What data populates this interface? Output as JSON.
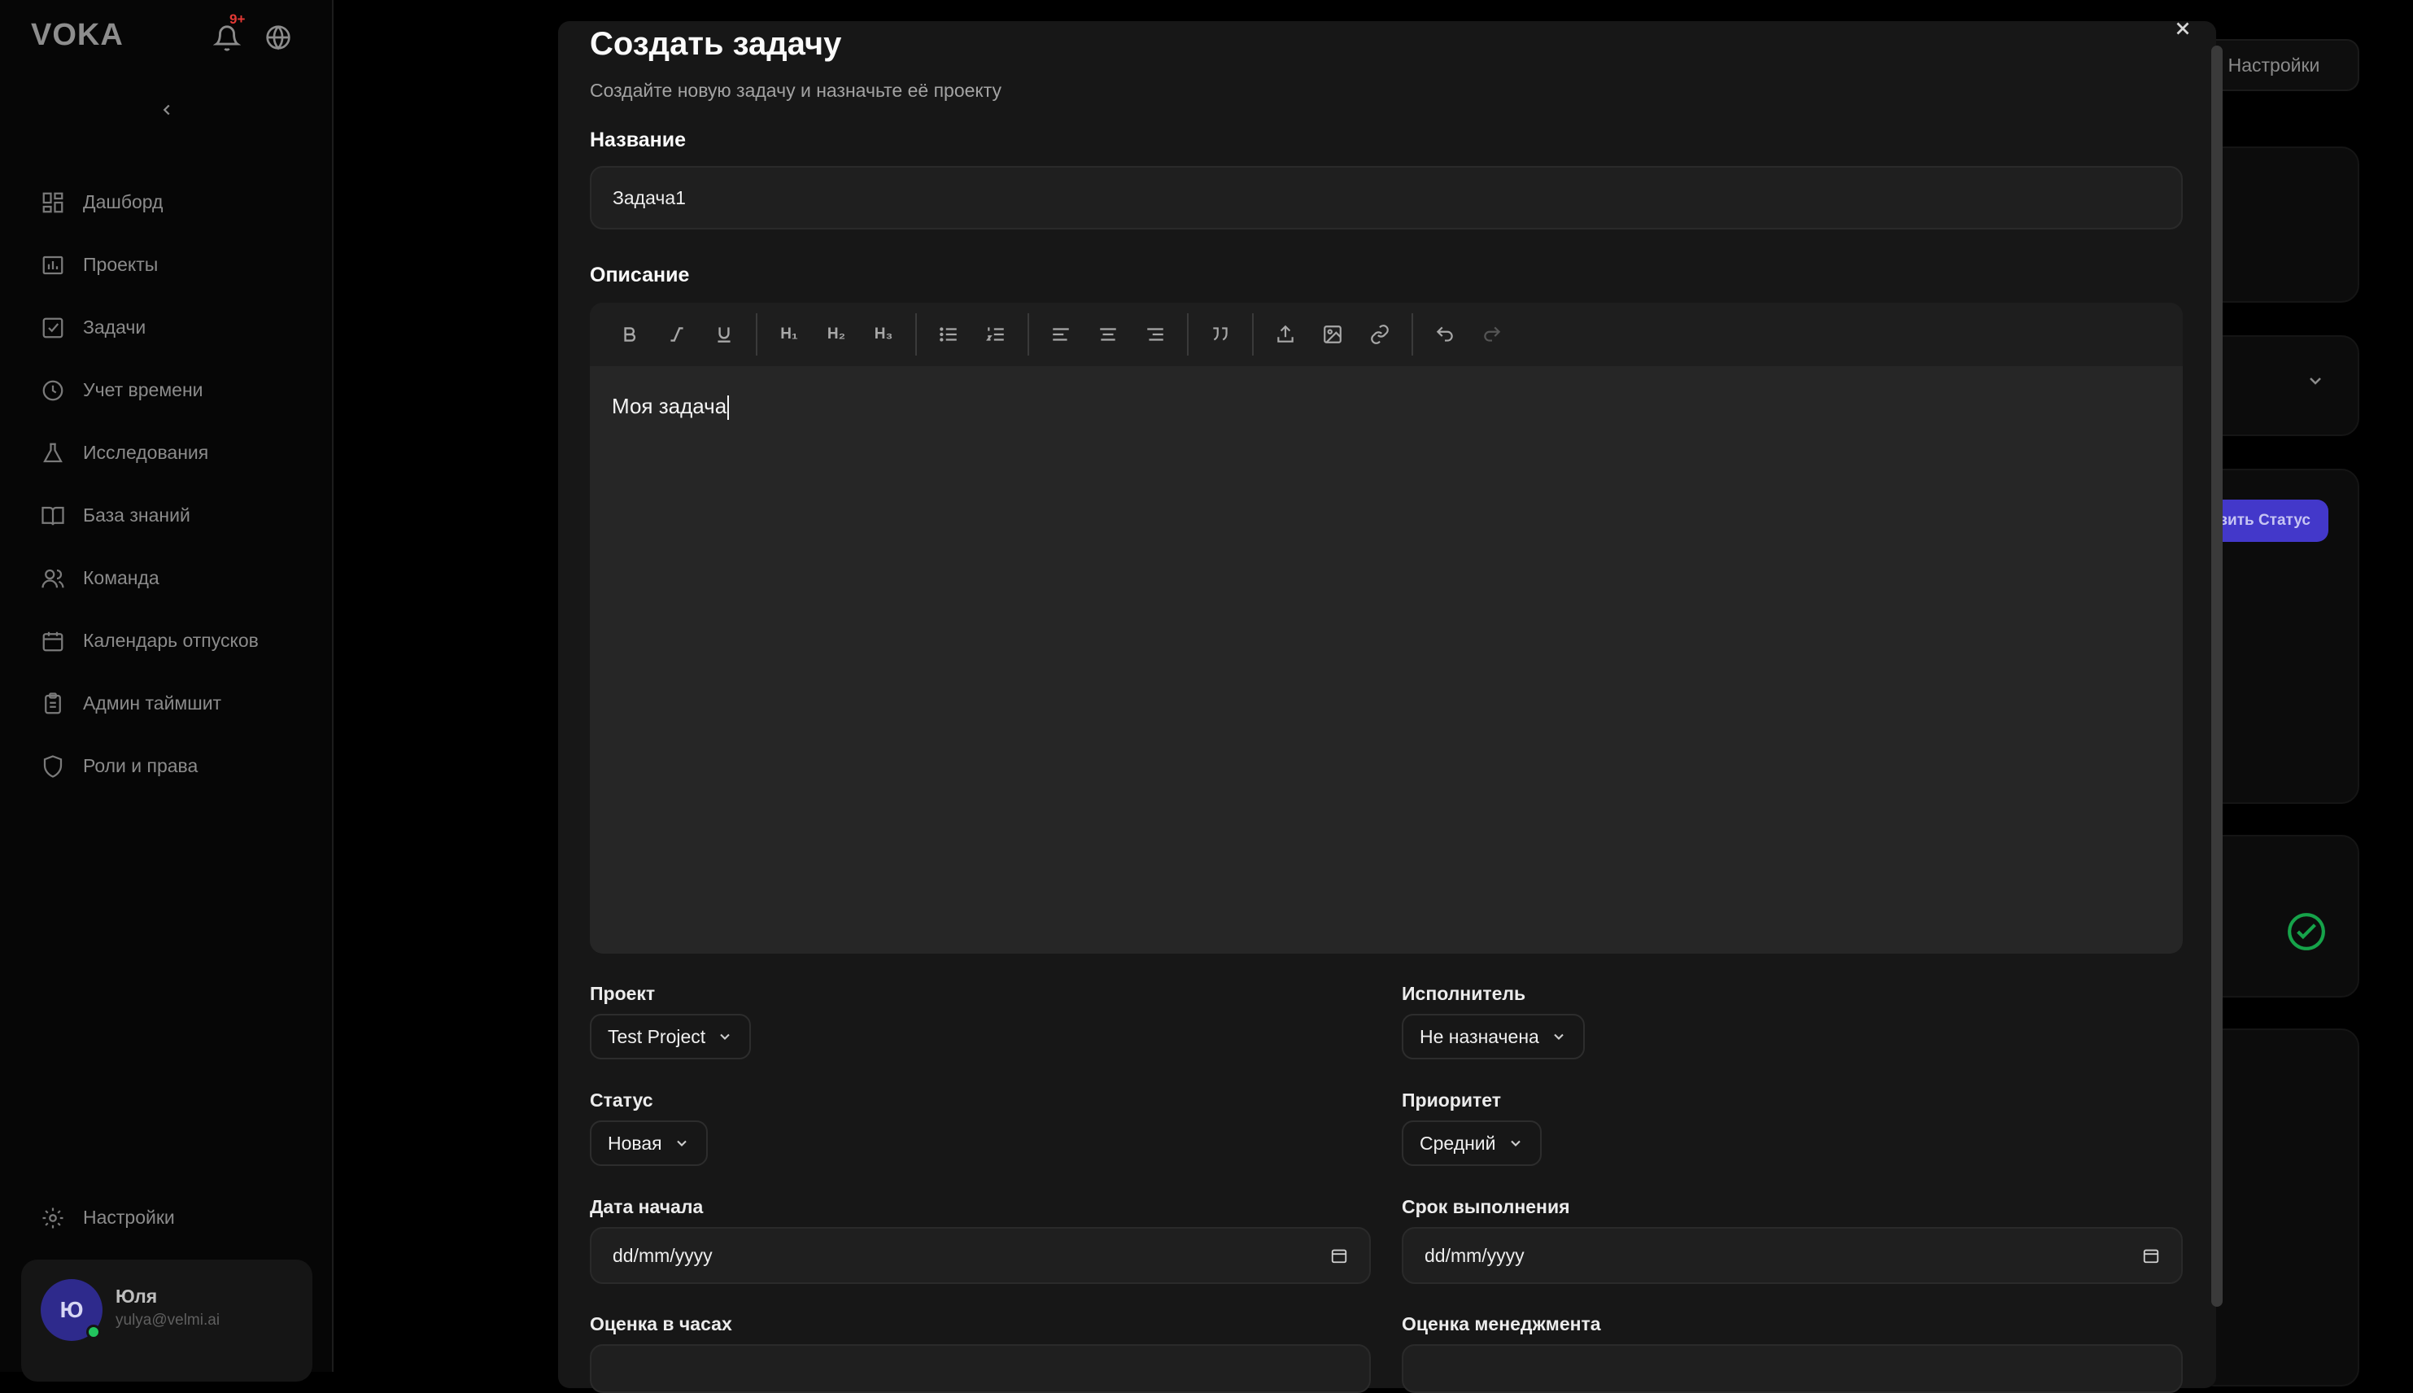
{
  "app": {
    "logo": "VOKA",
    "notifications_badge": "9+"
  },
  "sidebar": {
    "items": [
      {
        "label": "Дашборд",
        "icon": "dashboard-icon"
      },
      {
        "label": "Проекты",
        "icon": "projects-icon"
      },
      {
        "label": "Задачи",
        "icon": "tasks-icon"
      },
      {
        "label": "Учет времени",
        "icon": "clock-icon"
      },
      {
        "label": "Исследования",
        "icon": "flask-icon"
      },
      {
        "label": "База знаний",
        "icon": "book-icon"
      },
      {
        "label": "Команда",
        "icon": "team-icon"
      },
      {
        "label": "Календарь отпусков",
        "icon": "calendar-icon"
      },
      {
        "label": "Админ таймшит",
        "icon": "clipboard-icon"
      },
      {
        "label": "Роли и права",
        "icon": "shield-icon"
      }
    ],
    "settings_label": "Настройки",
    "user": {
      "initial": "Ю",
      "name": "Юля",
      "email": "yulya@velmi.ai"
    }
  },
  "background": {
    "settings_button": "Настройки",
    "status_button": "вить Статус"
  },
  "modal": {
    "title": "Создать задачу",
    "subtitle": "Создайте новую задачу и назначьте её проекту",
    "name_label": "Название",
    "name_value": "Задача1",
    "description_label": "Описание",
    "description_value": "Моя задача",
    "toolbar": {
      "h1": "H₁",
      "h2": "H₂",
      "h3": "H₃"
    },
    "project_label": "Проект",
    "project_value": "Test Project",
    "assignee_label": "Исполнитель",
    "assignee_value": "Не назначена",
    "status_label": "Статус",
    "status_value": "Новая",
    "priority_label": "Приоритет",
    "priority_value": "Средний",
    "start_label": "Дата начала",
    "start_placeholder": "dd/mm/yyyy",
    "due_label": "Срок выполнения",
    "due_placeholder": "dd/mm/yyyy",
    "estimate_label": "Оценка в часах",
    "mgmt_estimate_label": "Оценка менеджмента"
  }
}
